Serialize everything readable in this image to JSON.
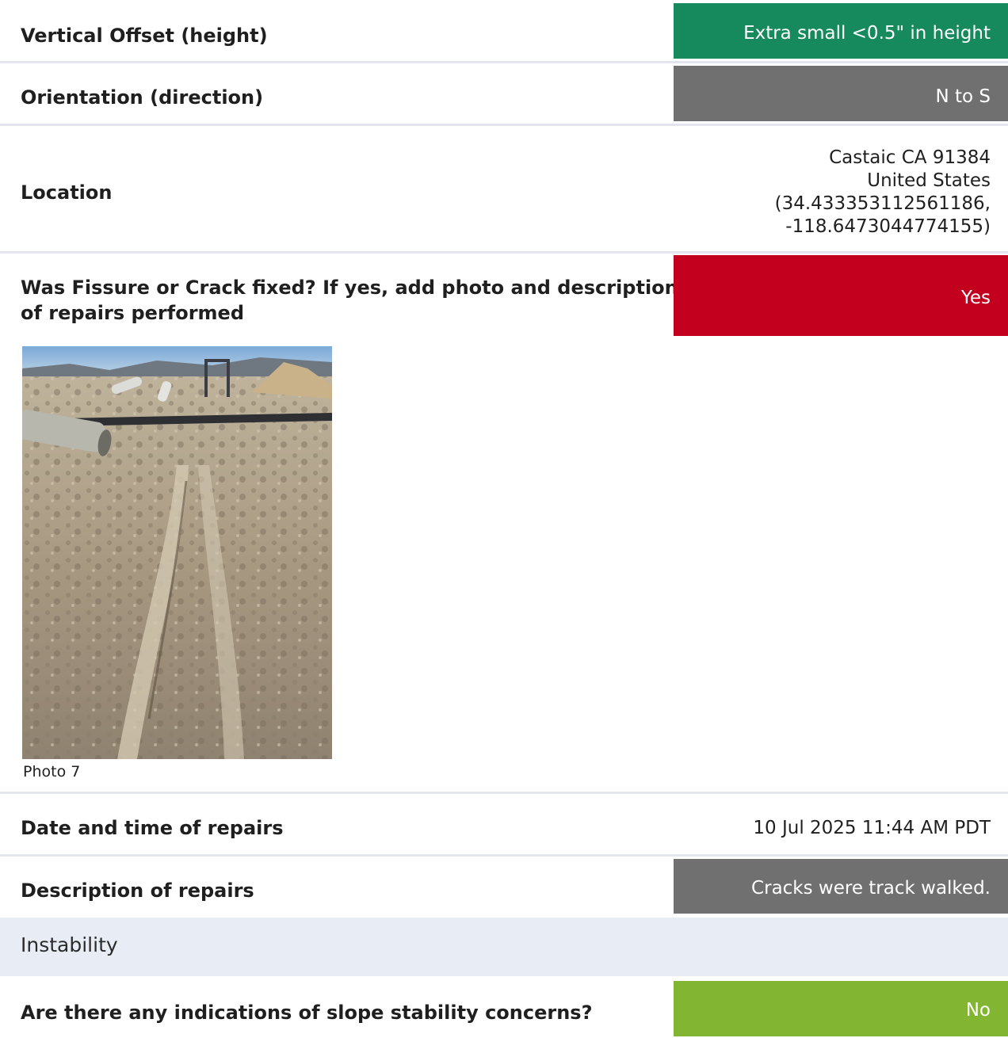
{
  "rows": {
    "vertical_offset": {
      "label": "Vertical Offset (height)",
      "value": "Extra small <0.5\" in height",
      "color": "#168a5c"
    },
    "orientation": {
      "label": "Orientation (direction)",
      "value": "N to S",
      "color": "#707070"
    },
    "location": {
      "label": "Location",
      "lines": [
        "Castaic CA 91384",
        "United States",
        "(34.433353112561186,",
        "-118.6473044774155)"
      ]
    },
    "fixed": {
      "label_line1": "Was Fissure or Crack fixed? If yes, add photo and description",
      "label_line2": "of repairs performed",
      "value": "Yes",
      "color": "#c4001f"
    },
    "photo": {
      "caption": "Photo 7"
    },
    "repair_date": {
      "label": "Date and time of repairs",
      "value": "10 Jul 2025 11:44 AM PDT"
    },
    "repair_description": {
      "label": "Description of repairs",
      "value": "Cracks were track walked.",
      "color": "#707070"
    }
  },
  "section": {
    "title": "Instability"
  },
  "slope": {
    "label": "Are there any indications of slope stability concerns?",
    "value": "No",
    "color": "#82b531"
  }
}
